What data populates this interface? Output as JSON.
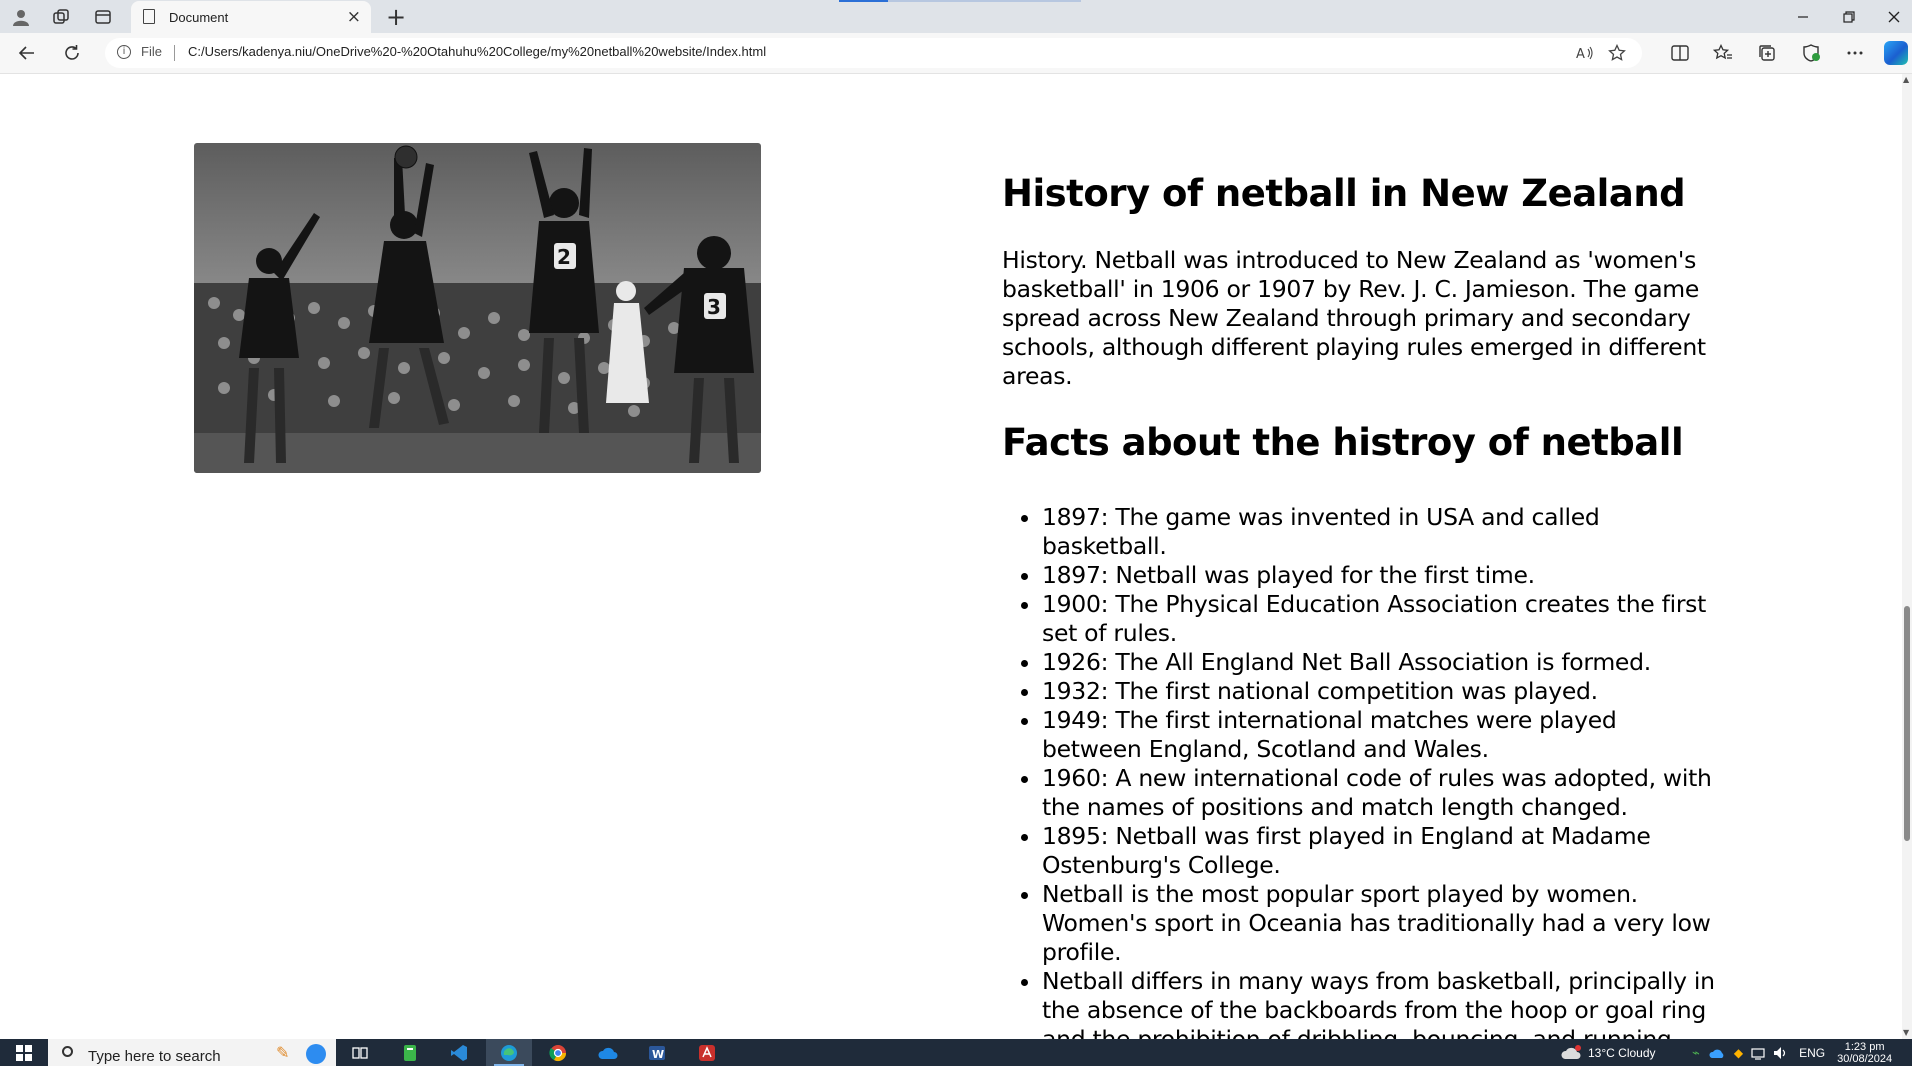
{
  "browser": {
    "tab_title": "Document",
    "tab_close": "×",
    "new_tab": "+",
    "address_scheme": "File",
    "url": "C:/Users/kadenya.niu/OneDrive%20-%20Otahuhu%20College/my%20netball%20website/Index.html"
  },
  "page": {
    "heading": "History of netball in New Zealand",
    "intro": "History. Netball was introduced to New Zealand as 'women's basketball' in 1906 or 1907 by Rev. J. C. Jamieson. The game spread across New Zealand through primary and secondary schools, although different playing rules emerged in different areas.",
    "facts_heading": "Facts about the histroy of netball",
    "facts": [
      "1897: The game was invented in USA and called basketball.",
      "1897: Netball was played for the first time.",
      "1900: The Physical Education Association creates the first set of rules.",
      "1926: The All England Net Ball Association is formed.",
      "1932: The first national competition was played.",
      "1949: The first international matches were played between England, Scotland and Wales.",
      "1960: A new international code of rules was adopted, with the names of positions and match length changed.",
      "1895: Netball was first played in England at Madame Ostenburg's College.",
      "Netball is the most popular sport played by women. Women's sport in Oceania has traditionally had a very low profile.",
      "Netball differs in many ways from basketball, principally in the absence of the backboards from the hoop or goal ring and the prohibition of dribbling, bouncing, and running while in possession of the ball. Physical player contact is"
    ]
  },
  "taskbar": {
    "search_placeholder": "Type here to search",
    "weather": "13°C  Cloudy",
    "language": "ENG",
    "time": "1:23 pm",
    "date": "30/08/2024"
  }
}
